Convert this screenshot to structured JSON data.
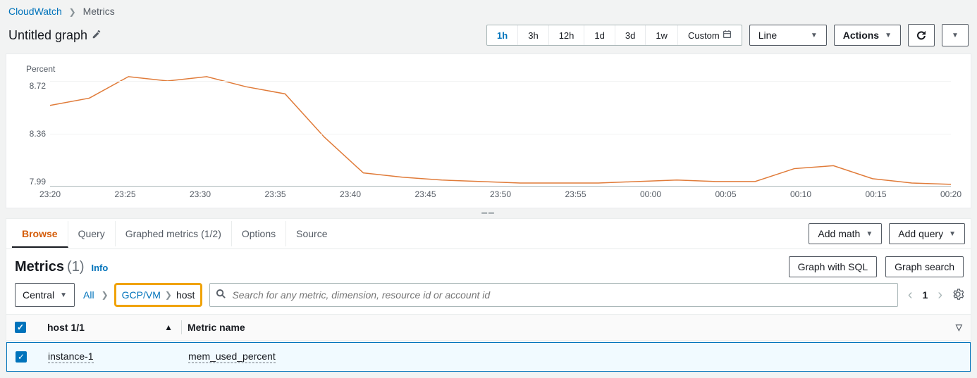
{
  "breadcrumb": {
    "root": "CloudWatch",
    "current": "Metrics"
  },
  "graph": {
    "title": "Untitled graph"
  },
  "timeRange": {
    "options": [
      "1h",
      "3h",
      "12h",
      "1d",
      "3d",
      "1w",
      "Custom"
    ],
    "active": "1h"
  },
  "chartTypeSelect": "Line",
  "actions": "Actions",
  "chart_data": {
    "type": "line",
    "title": "",
    "ylabel": "Percent",
    "xlabel": "",
    "y_ticks": [
      "8.72",
      "8.36",
      "7.99"
    ],
    "ylim": [
      7.99,
      8.72
    ],
    "x_ticks": [
      "23:20",
      "23:25",
      "23:30",
      "23:35",
      "23:40",
      "23:45",
      "23:50",
      "23:55",
      "00:00",
      "00:05",
      "00:10",
      "00:15",
      "00:20"
    ],
    "series": [
      {
        "name": "mem_used_percent",
        "color": "#e07b39",
        "values": [
          8.55,
          8.6,
          8.75,
          8.72,
          8.75,
          8.68,
          8.63,
          8.33,
          8.08,
          8.05,
          8.03,
          8.02,
          8.01,
          8.01,
          8.01,
          8.02,
          8.03,
          8.02,
          8.02,
          8.11,
          8.13,
          8.04,
          8.01,
          8.0
        ]
      }
    ],
    "x_count": 24
  },
  "tabs": {
    "items": [
      "Browse",
      "Query",
      "Graphed metrics (1/2)",
      "Options",
      "Source"
    ],
    "active": "Browse",
    "addMath": "Add math",
    "addQuery": "Add query"
  },
  "metricsHeader": {
    "title": "Metrics",
    "count": "(1)",
    "info": "Info",
    "graphWithSql": "Graph with SQL",
    "graphSearch": "Graph search"
  },
  "filter": {
    "region": "Central",
    "all": "All",
    "path": [
      "GCP/VM",
      "host"
    ],
    "searchPlaceholder": "Search for any metric, dimension, resource id or account id",
    "page": "1"
  },
  "table": {
    "headers": {
      "host": "host 1/1",
      "metric": "Metric name"
    },
    "rows": [
      {
        "checked": true,
        "host": "instance-1",
        "metric": "mem_used_percent"
      }
    ]
  }
}
